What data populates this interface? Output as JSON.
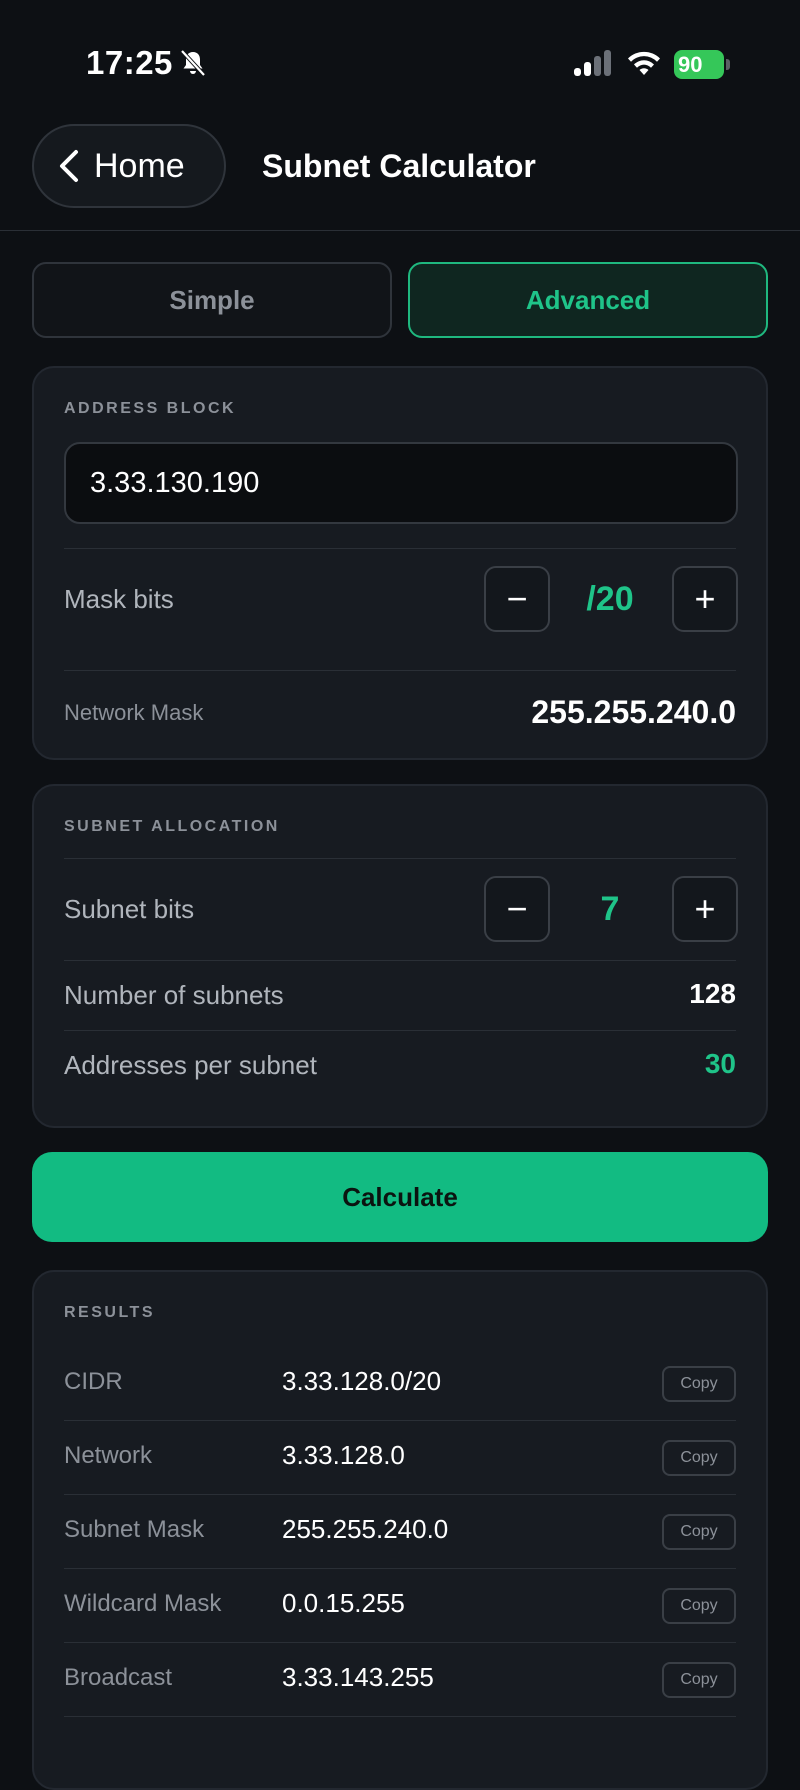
{
  "status": {
    "time": "17:25",
    "battery": "90"
  },
  "header": {
    "back_label": "Home",
    "title": "Subnet Calculator"
  },
  "modes": {
    "simple": "Simple",
    "advanced": "Advanced",
    "active": "Advanced"
  },
  "address_block": {
    "label": "ADDRESS BLOCK",
    "address_value": "3.33.130.190",
    "mask_bits_label": "Mask bits",
    "mask_bits_value": "/20",
    "network_mask_label": "Network Mask",
    "network_mask_value": "255.255.240.0"
  },
  "subnet_allocation": {
    "label": "SUBNET ALLOCATION",
    "subnet_bits_label": "Subnet bits",
    "subnet_bits_value": "7",
    "num_subnets_label": "Number of subnets",
    "num_subnets_value": "128",
    "addr_per_subnet_label": "Addresses per subnet",
    "addr_per_subnet_value": "30"
  },
  "calculate_label": "Calculate",
  "results": {
    "label": "RESULTS",
    "copy_label": "Copy",
    "rows": [
      {
        "key": "CIDR",
        "value": "3.33.128.0/20"
      },
      {
        "key": "Network",
        "value": "3.33.128.0"
      },
      {
        "key": "Subnet Mask",
        "value": "255.255.240.0"
      },
      {
        "key": "Wildcard Mask",
        "value": "0.0.15.255"
      },
      {
        "key": "Broadcast",
        "value": "3.33.143.255"
      }
    ]
  },
  "colors": {
    "accent": "#12bb82",
    "background": "#0d1014",
    "card": "#171b21"
  }
}
